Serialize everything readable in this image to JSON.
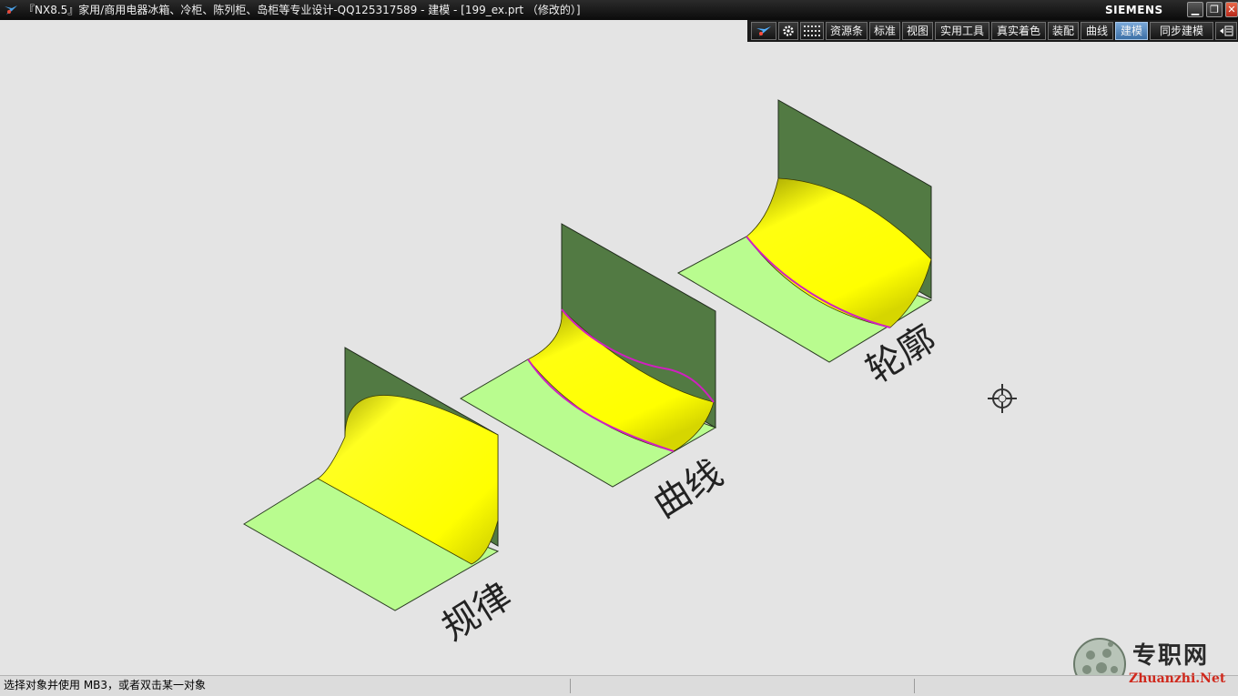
{
  "window": {
    "title": "『NX8.5』家用/商用电器冰箱、冷柜、陈列柜、岛柜等专业设计-QQ125317589 - 建模 - [199_ex.prt （修改的）]",
    "brand": "SIEMENS",
    "buttons": {
      "minimize": "▁",
      "restore": "❐",
      "close": "✕"
    }
  },
  "toolbar": {
    "items": [
      {
        "label": "资源条"
      },
      {
        "label": "标准"
      },
      {
        "label": "视图"
      },
      {
        "label": "实用工具"
      },
      {
        "label": "真实着色"
      },
      {
        "label": "装配"
      },
      {
        "label": "曲线"
      },
      {
        "label": "建模",
        "active": true
      },
      {
        "label": "同步建模"
      }
    ],
    "icons": [
      "nx-logo-icon",
      "gear-icon",
      "grid-icon"
    ]
  },
  "viewport": {
    "labels": {
      "rule": "规律",
      "curve": "曲线",
      "contour": "轮廓"
    },
    "colors": {
      "background": "#e4e4e4",
      "wall": "#527a43",
      "floor": "#b9fc8f",
      "fillet": "#ffff00",
      "curve": "#d020c0"
    },
    "cursor_icon": "crosshair-cursor-icon"
  },
  "watermark": {
    "cn": "专职网",
    "en": "Zhuanzhi.Net"
  },
  "status": {
    "message": "选择对象并使用 MB3，或者双击某一对象"
  }
}
